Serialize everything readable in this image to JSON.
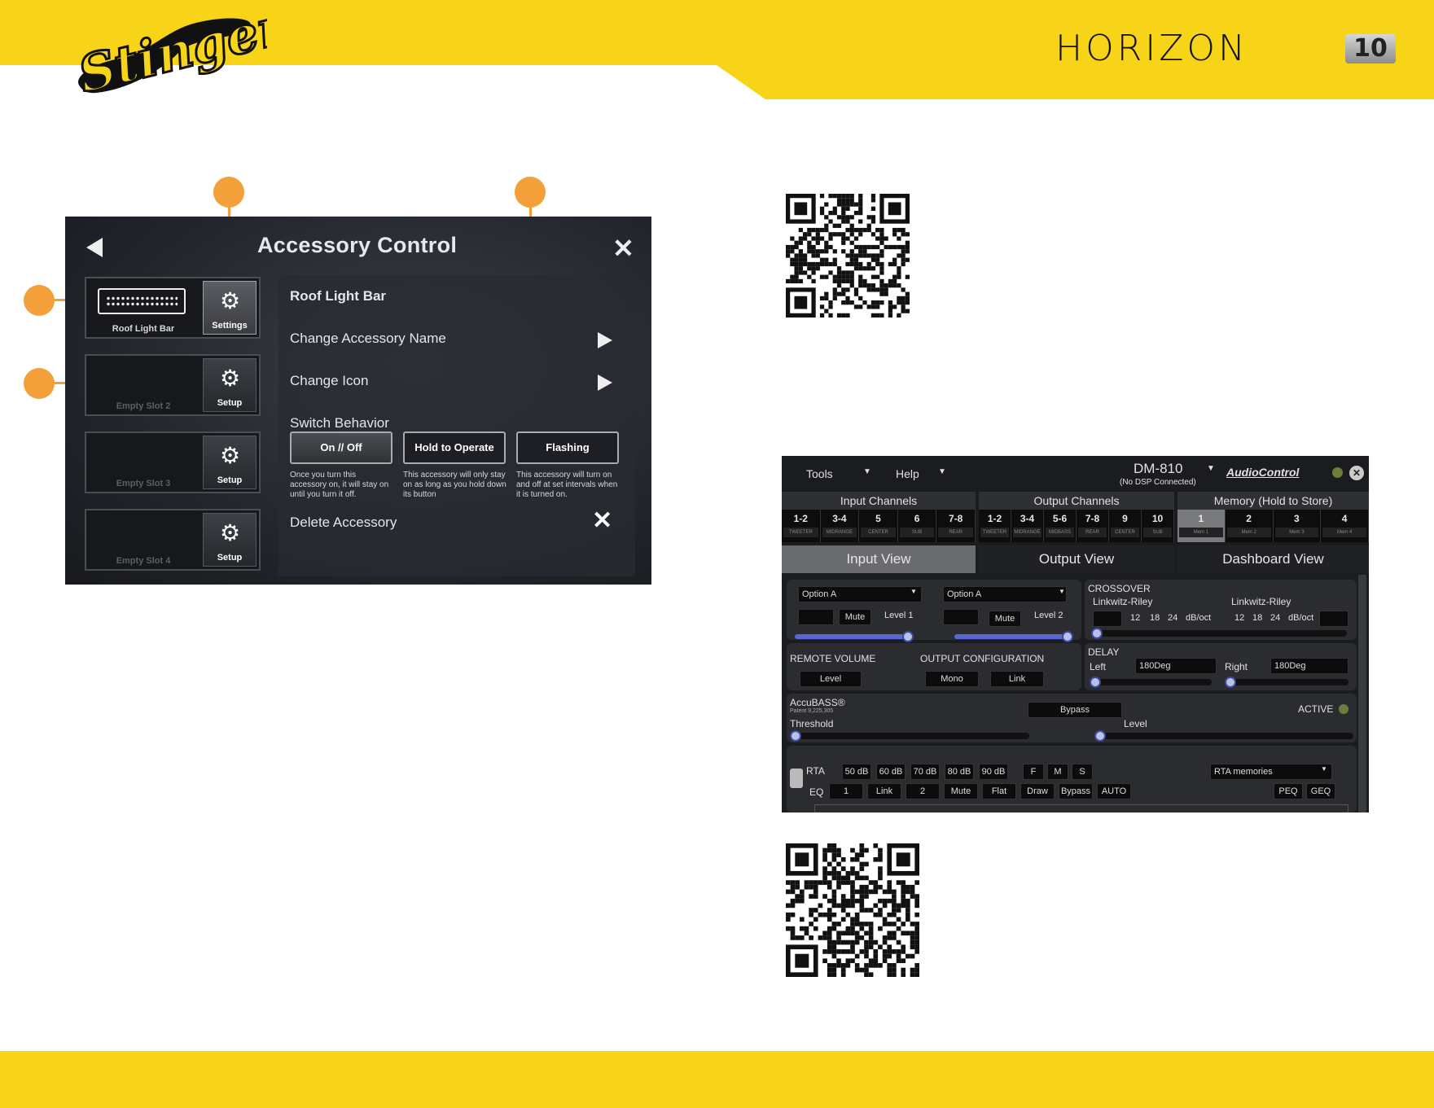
{
  "header": {
    "brand": "Stinger",
    "product": "HORIZON",
    "product_suffix": "10"
  },
  "accessory_control": {
    "title": "Accessory Control",
    "slots": [
      {
        "name": "Roof Light Bar",
        "button": "Settings",
        "active": true
      },
      {
        "name": "Empty Slot 2",
        "button": "Setup",
        "active": false
      },
      {
        "name": "Empty Slot 3",
        "button": "Setup",
        "active": false
      },
      {
        "name": "Empty Slot 4",
        "button": "Setup",
        "active": false
      }
    ],
    "panel": {
      "title": "Roof Light Bar",
      "change_name": "Change Accessory Name",
      "change_icon": "Change Icon",
      "switch_behavior": "Switch Behavior",
      "behaviors": [
        {
          "label": "On // Off",
          "desc": "Once you turn this accessory on, it will stay on until you turn it off.",
          "selected": true
        },
        {
          "label": "Hold to Operate",
          "desc": "This accessory will only stay on as long as you hold down its button",
          "selected": false
        },
        {
          "label": "Flashing",
          "desc": "This accessory will turn on and off at set intervals when it is turned on.",
          "selected": false
        }
      ],
      "delete": "Delete Accessory"
    }
  },
  "dsp": {
    "menu": {
      "tools": "Tools",
      "help": "Help"
    },
    "device": "DM-810",
    "device_status": "(No DSP Connected)",
    "logo": "AudioControl",
    "input_channels": "Input Channels",
    "output_channels": "Output Channels",
    "memory": "Memory (Hold to Store)",
    "inputs": [
      {
        "n": "1-2",
        "s": "TWEETER"
      },
      {
        "n": "3-4",
        "s": "MIDRANGE"
      },
      {
        "n": "5",
        "s": "CENTER"
      },
      {
        "n": "6",
        "s": "SUB"
      },
      {
        "n": "7-8",
        "s": "REAR"
      }
    ],
    "outputs": [
      {
        "n": "1-2",
        "s": "TWEETER"
      },
      {
        "n": "3-4",
        "s": "MIDRANGE"
      },
      {
        "n": "5-6",
        "s": "MIDBASS"
      },
      {
        "n": "7-8",
        "s": "REAR"
      },
      {
        "n": "9",
        "s": "CENTER"
      },
      {
        "n": "10",
        "s": "SUB"
      }
    ],
    "memories": [
      {
        "n": "1",
        "s": "Mem 1"
      },
      {
        "n": "2",
        "s": "Mem 2"
      },
      {
        "n": "3",
        "s": "Mem 3"
      },
      {
        "n": "4",
        "s": "Mem 4"
      }
    ],
    "views": [
      "Input View",
      "Output View",
      "Dashboard View"
    ],
    "option_a": "Option A",
    "option_b": "Option A",
    "mute": "Mute",
    "level1": "Level 1",
    "level2": "Level 2",
    "crossover": "CROSSOVER",
    "lr1": "Linkwitz-Riley",
    "lr2": "Linkwitz-Riley",
    "slopes": [
      "12",
      "18",
      "24"
    ],
    "dboct": "dB/oct",
    "remote_volume": "REMOTE VOLUME",
    "level": "Level",
    "output_config": "OUTPUT CONFIGURATION",
    "mono": "Mono",
    "link": "Link",
    "delay": "DELAY",
    "left": "Left",
    "right": "Right",
    "deg": "180Deg",
    "accubass": "AccuBASS®",
    "patent": "Patent 9,225,305",
    "bypass": "Bypass",
    "active": "ACTIVE",
    "threshold": "Threshold",
    "level_b": "Level",
    "rta": "RTA",
    "eq": "EQ",
    "rta_db": [
      "50 dB",
      "60 dB",
      "70 dB",
      "80 dB",
      "90 dB"
    ],
    "fms": [
      "F",
      "M",
      "S"
    ],
    "rta_memories": "RTA memories",
    "eq_buttons": [
      "1",
      "Link",
      "2",
      "Mute",
      "Flat",
      "Draw",
      "Bypass",
      "AUTO"
    ],
    "peq": "PEQ",
    "geq": "GEQ"
  },
  "colors": {
    "yellow": "#f7d418",
    "callout": "#f4a03a"
  }
}
